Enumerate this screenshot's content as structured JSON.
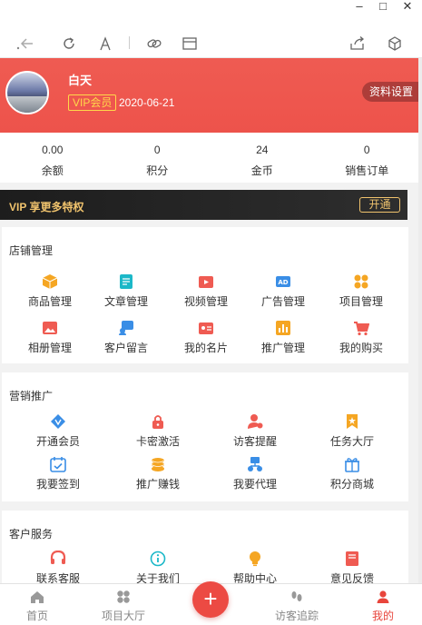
{
  "window": {
    "minimize": "–",
    "maximize": "□",
    "close": "✕"
  },
  "toolbar": {
    "icons": [
      "back-icon",
      "refresh-icon",
      "font-icon",
      "link-icon",
      "window-icon",
      "share-icon",
      "cube-icon"
    ]
  },
  "profile": {
    "name": "白天",
    "vip_label": "VIP会员",
    "vip_date": "2020-06-21",
    "settings_button": "资料设置"
  },
  "stats": [
    {
      "value": "0.00",
      "label": "余额"
    },
    {
      "value": "0",
      "label": "积分"
    },
    {
      "value": "24",
      "label": "金币"
    },
    {
      "value": "0",
      "label": "销售订单"
    }
  ],
  "vip_strip": {
    "label": "VIP 享更多特权",
    "button": "开通"
  },
  "sections": [
    {
      "title": "店铺管理",
      "items": [
        {
          "label": "商品管理",
          "icon": "box-icon",
          "color": "#f5a623"
        },
        {
          "label": "文章管理",
          "icon": "article-icon",
          "color": "#1cb8c8"
        },
        {
          "label": "视频管理",
          "icon": "video-icon",
          "color": "#ef5b52"
        },
        {
          "label": "广告管理",
          "icon": "ad-icon",
          "color": "#3a8ee6"
        },
        {
          "label": "项目管理",
          "icon": "grid-icon",
          "color": "#f5a623"
        },
        {
          "label": "相册管理",
          "icon": "image-icon",
          "color": "#ef5b52"
        },
        {
          "label": "客户留言",
          "icon": "message-icon",
          "color": "#3a8ee6"
        },
        {
          "label": "我的名片",
          "icon": "card-icon",
          "color": "#ef5b52"
        },
        {
          "label": "推广管理",
          "icon": "chart-icon",
          "color": "#f5a623"
        },
        {
          "label": "我的购买",
          "icon": "cart-icon",
          "color": "#ef5b52"
        }
      ]
    },
    {
      "title": "营销推广",
      "items": [
        {
          "label": "开通会员",
          "icon": "vip-diamond-icon",
          "color": "#3a8ee6"
        },
        {
          "label": "卡密激活",
          "icon": "lock-icon",
          "color": "#ef5b52"
        },
        {
          "label": "访客提醒",
          "icon": "user-bell-icon",
          "color": "#ef5b52"
        },
        {
          "label": "任务大厅",
          "icon": "bookmark-icon",
          "color": "#f5a623"
        },
        {
          "label": "我要签到",
          "icon": "calendar-icon",
          "color": "#3a8ee6"
        },
        {
          "label": "推广赚钱",
          "icon": "coins-icon",
          "color": "#f5a623"
        },
        {
          "label": "我要代理",
          "icon": "agent-icon",
          "color": "#3a8ee6"
        },
        {
          "label": "积分商城",
          "icon": "gift-icon",
          "color": "#3a8ee6"
        }
      ]
    },
    {
      "title": "客户服务",
      "items": [
        {
          "label": "联系客服",
          "icon": "headset-icon",
          "color": "#ef5b52"
        },
        {
          "label": "关于我们",
          "icon": "info-icon",
          "color": "#1cb8c8"
        },
        {
          "label": "帮助中心",
          "icon": "bulb-icon",
          "color": "#f5a623"
        },
        {
          "label": "意见反馈",
          "icon": "feedback-icon",
          "color": "#ef5b52"
        }
      ]
    }
  ],
  "tabbar": [
    {
      "label": "首页",
      "icon": "home-icon",
      "active": false
    },
    {
      "label": "项目大厅",
      "icon": "apps-icon",
      "active": false
    },
    {
      "label": "访客追踪",
      "icon": "footprint-icon",
      "active": false
    },
    {
      "label": "我的",
      "icon": "person-icon",
      "active": true
    }
  ],
  "fab": {
    "label": "+"
  },
  "colors": {
    "accent": "#ec4e47",
    "vip_gold": "#f0c36d",
    "badge_yellow": "#ffd84a"
  }
}
